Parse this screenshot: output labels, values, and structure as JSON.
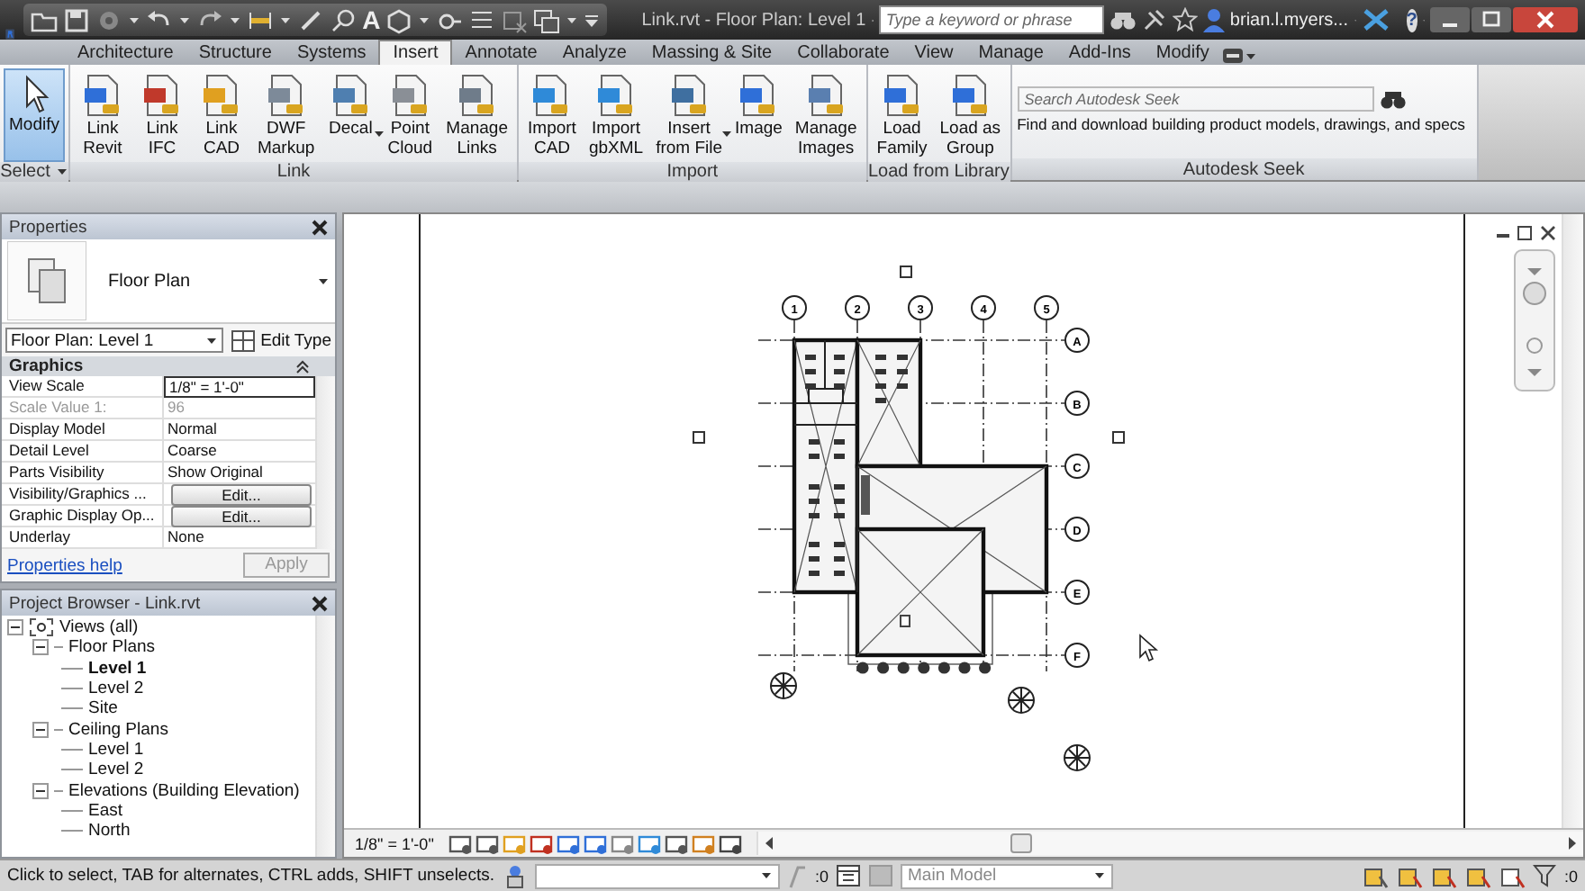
{
  "window": {
    "title": "Link.rvt - Floor Plan: Level 1",
    "text_tool": "A",
    "help": "?"
  },
  "search": {
    "placeholder": "Type a keyword or phrase"
  },
  "user": {
    "name": "brian.l.myers..."
  },
  "tabs": [
    {
      "label": "Architecture",
      "selected": false
    },
    {
      "label": "Structure",
      "selected": false
    },
    {
      "label": "Systems",
      "selected": false
    },
    {
      "label": "Insert",
      "selected": true
    },
    {
      "label": "Annotate",
      "selected": false
    },
    {
      "label": "Analyze",
      "selected": false
    },
    {
      "label": "Massing & Site",
      "selected": false
    },
    {
      "label": "Collaborate",
      "selected": false
    },
    {
      "label": "View",
      "selected": false
    },
    {
      "label": "Manage",
      "selected": false
    },
    {
      "label": "Add-Ins",
      "selected": false
    },
    {
      "label": "Modify",
      "selected": false
    }
  ],
  "ribbon": {
    "panels": [
      {
        "title": "Select",
        "menu": true,
        "buttons": [
          {
            "label": "Modify",
            "selected": true,
            "menu": false
          }
        ]
      },
      {
        "title": "Link",
        "menu": false,
        "buttons": [
          {
            "label": "Link\nRevit",
            "selected": false,
            "menu": false
          },
          {
            "label": "Link\nIFC",
            "selected": false,
            "menu": false
          },
          {
            "label": "Link\nCAD",
            "selected": false,
            "menu": false
          },
          {
            "label": "DWF\nMarkup",
            "selected": false,
            "menu": false
          },
          {
            "label": "Decal",
            "selected": false,
            "menu": true
          },
          {
            "label": "Point\nCloud",
            "selected": false,
            "menu": false
          },
          {
            "label": "Manage\nLinks",
            "selected": false,
            "menu": false
          }
        ]
      },
      {
        "title": "Import",
        "menu": false,
        "buttons": [
          {
            "label": "Import\nCAD",
            "selected": false,
            "menu": false
          },
          {
            "label": "Import\ngbXML",
            "selected": false,
            "menu": false
          },
          {
            "label": "Insert\nfrom File",
            "selected": false,
            "menu": true
          },
          {
            "label": "Image",
            "selected": false,
            "menu": false
          },
          {
            "label": "Manage\nImages",
            "selected": false,
            "menu": false
          }
        ]
      },
      {
        "title": "Load from Library",
        "menu": false,
        "buttons": [
          {
            "label": "Load\nFamily",
            "selected": false,
            "menu": false
          },
          {
            "label": "Load as\nGroup",
            "selected": false,
            "menu": false
          }
        ]
      }
    ],
    "seek": {
      "title": "Autodesk Seek",
      "placeholder": "Search Autodesk Seek",
      "description": "Find and download building product models, drawings, and specs"
    }
  },
  "properties": {
    "title": "Properties",
    "type": "Floor Plan",
    "selector": "Floor Plan: Level 1",
    "edit_type": "Edit Type",
    "group": "Graphics",
    "rows": [
      {
        "name": "View Scale",
        "value": "1/8\" = 1'-0\"",
        "kind": "field",
        "disabled": false
      },
      {
        "name": "Scale Value    1:",
        "value": "96",
        "kind": "text",
        "disabled": true
      },
      {
        "name": "Display Model",
        "value": "Normal",
        "kind": "text",
        "disabled": false
      },
      {
        "name": "Detail Level",
        "value": "Coarse",
        "kind": "text",
        "disabled": false
      },
      {
        "name": "Parts Visibility",
        "value": "Show Original",
        "kind": "text",
        "disabled": false
      },
      {
        "name": "Visibility/Graphics ...",
        "value": "Edit...",
        "kind": "button",
        "disabled": false
      },
      {
        "name": "Graphic Display Op...",
        "value": "Edit...",
        "kind": "button",
        "disabled": false
      },
      {
        "name": "Underlay",
        "value": "None",
        "kind": "text",
        "disabled": false
      }
    ],
    "help": "Properties help",
    "apply": {
      "label": "Apply",
      "disabled": true
    }
  },
  "project_browser": {
    "title": "Project Browser - Link.rvt",
    "tree": [
      {
        "label": "Views (all)",
        "selected": false,
        "expanded": true,
        "children": [
          {
            "label": "Floor Plans",
            "selected": false,
            "expanded": true,
            "children": [
              {
                "label": "Level 1",
                "selected": true
              },
              {
                "label": "Level 2",
                "selected": false
              },
              {
                "label": "Site",
                "selected": false
              }
            ]
          },
          {
            "label": "Ceiling Plans",
            "selected": false,
            "expanded": true,
            "children": [
              {
                "label": "Level 1",
                "selected": false
              },
              {
                "label": "Level 2",
                "selected": false
              }
            ]
          },
          {
            "label": "Elevations (Building Elevation)",
            "selected": false,
            "expanded": true,
            "children": [
              {
                "label": "East",
                "selected": false
              },
              {
                "label": "North",
                "selected": false
              }
            ]
          }
        ]
      }
    ]
  },
  "plan": {
    "grid_columns": [
      "1",
      "2",
      "3",
      "4",
      "5"
    ],
    "grid_rows": [
      "A",
      "B",
      "C",
      "D",
      "E",
      "F"
    ]
  },
  "view_bar": {
    "scale": "1/8\" = 1'-0\""
  },
  "status_bar": {
    "message": "Click to select, TAB for alternates, CTRL adds, SHIFT unselects.",
    "worksharing_count": ":0",
    "design_option": "Main Model",
    "filter_count": ":0"
  }
}
